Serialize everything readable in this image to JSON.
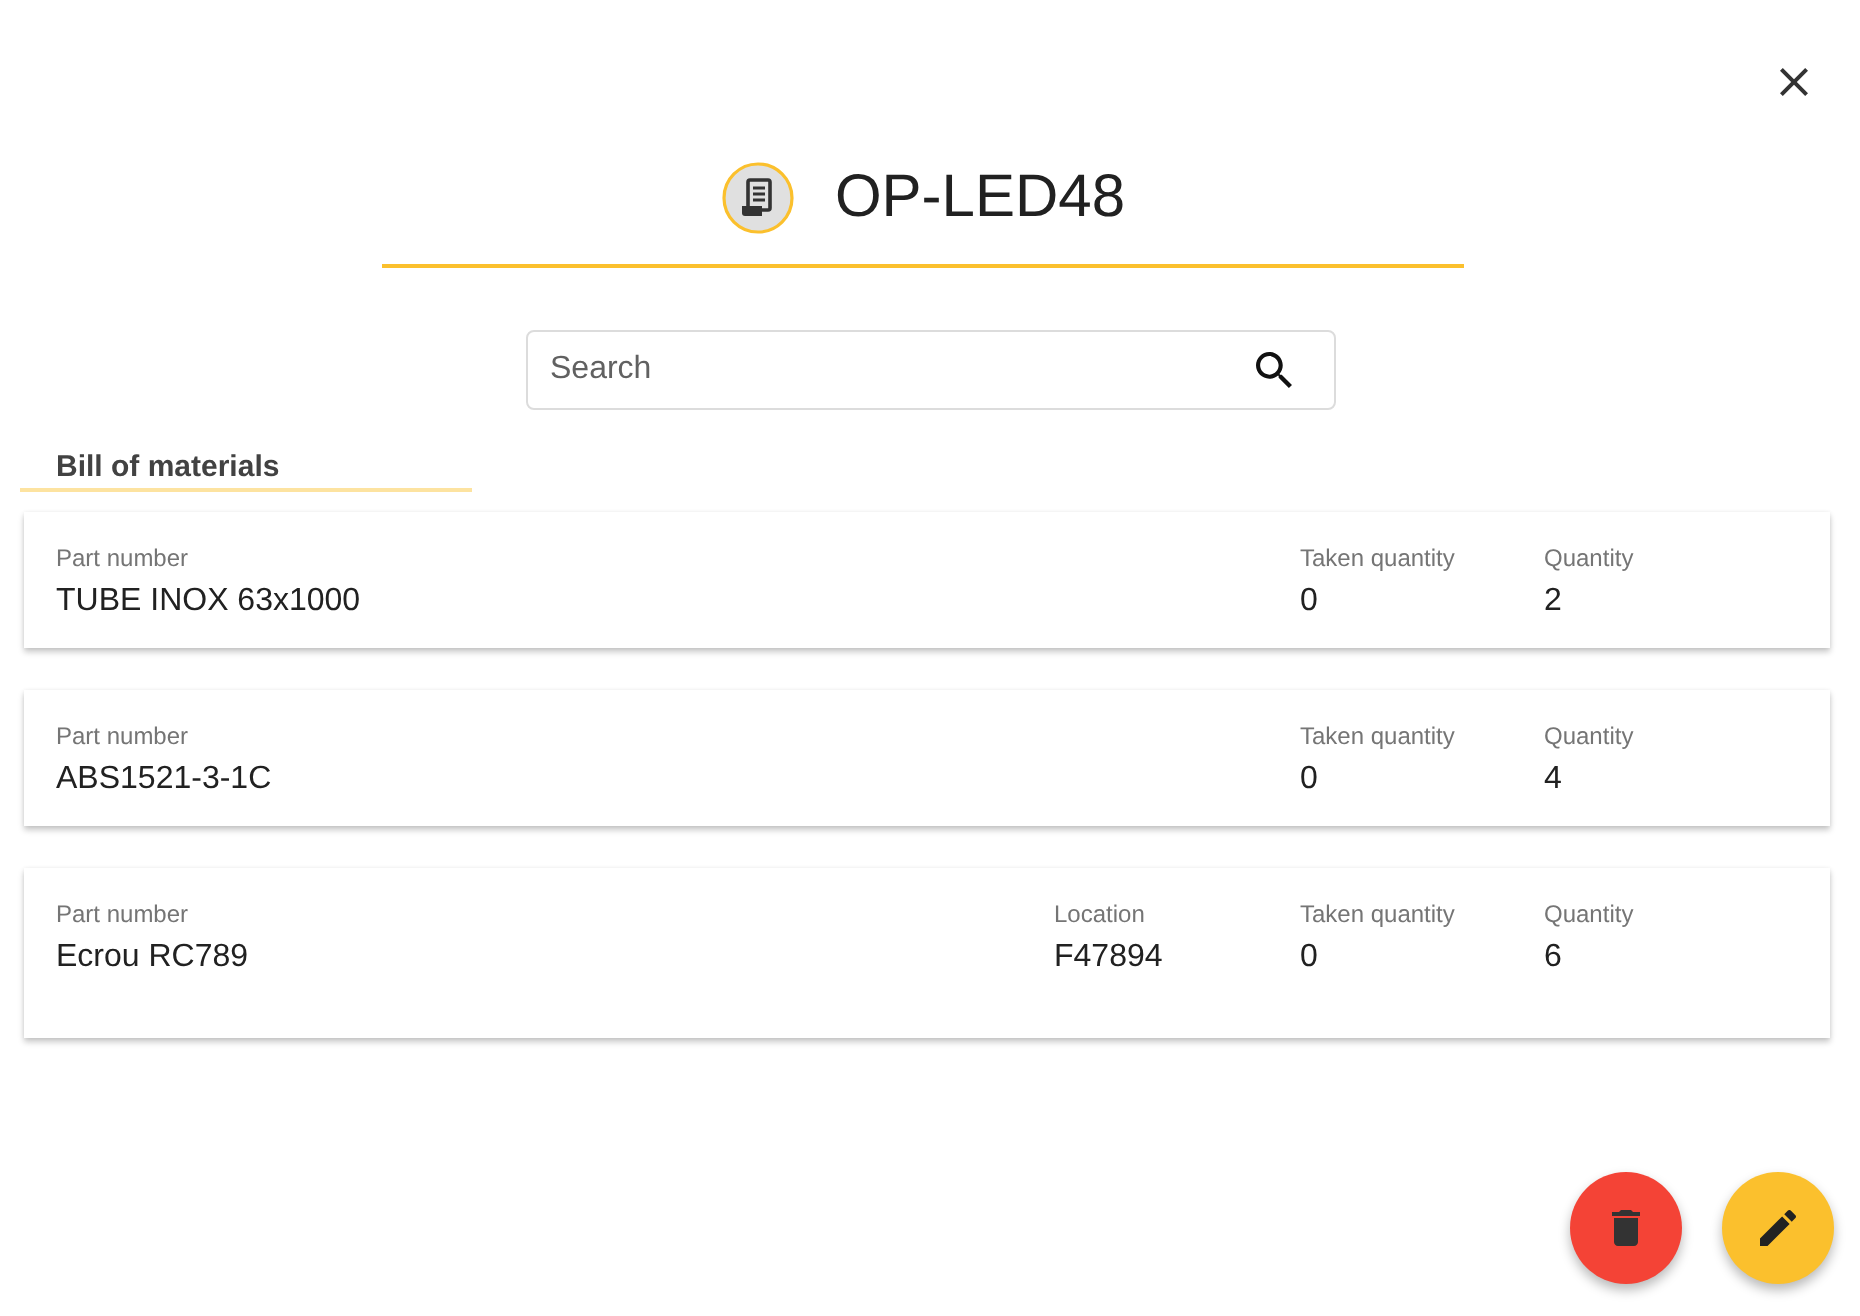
{
  "header": {
    "title": "OP-LED48"
  },
  "search": {
    "placeholder": "Search"
  },
  "bill_of_materials": {
    "title": "Bill of materials",
    "items": [
      {
        "fields": [
          {
            "kind": "part",
            "label": "Part number",
            "value": "TUBE INOX 63x1000"
          },
          {
            "kind": "taken",
            "label": "Taken quantity",
            "value": "0"
          },
          {
            "kind": "quantity",
            "label": "Quantity",
            "value": "2"
          }
        ]
      },
      {
        "fields": [
          {
            "kind": "part",
            "label": "Part number",
            "value": "ABS1521-3-1C"
          },
          {
            "kind": "taken",
            "label": "Taken quantity",
            "value": "0"
          },
          {
            "kind": "quantity",
            "label": "Quantity",
            "value": "4"
          }
        ]
      },
      {
        "fields": [
          {
            "kind": "part",
            "label": "Part number",
            "value": "Ecrou RC789"
          },
          {
            "kind": "location",
            "label": "Location",
            "value": "F47894"
          },
          {
            "kind": "taken",
            "label": "Taken quantity",
            "value": "0"
          },
          {
            "kind": "quantity",
            "label": "Quantity",
            "value": "6"
          }
        ]
      }
    ]
  }
}
